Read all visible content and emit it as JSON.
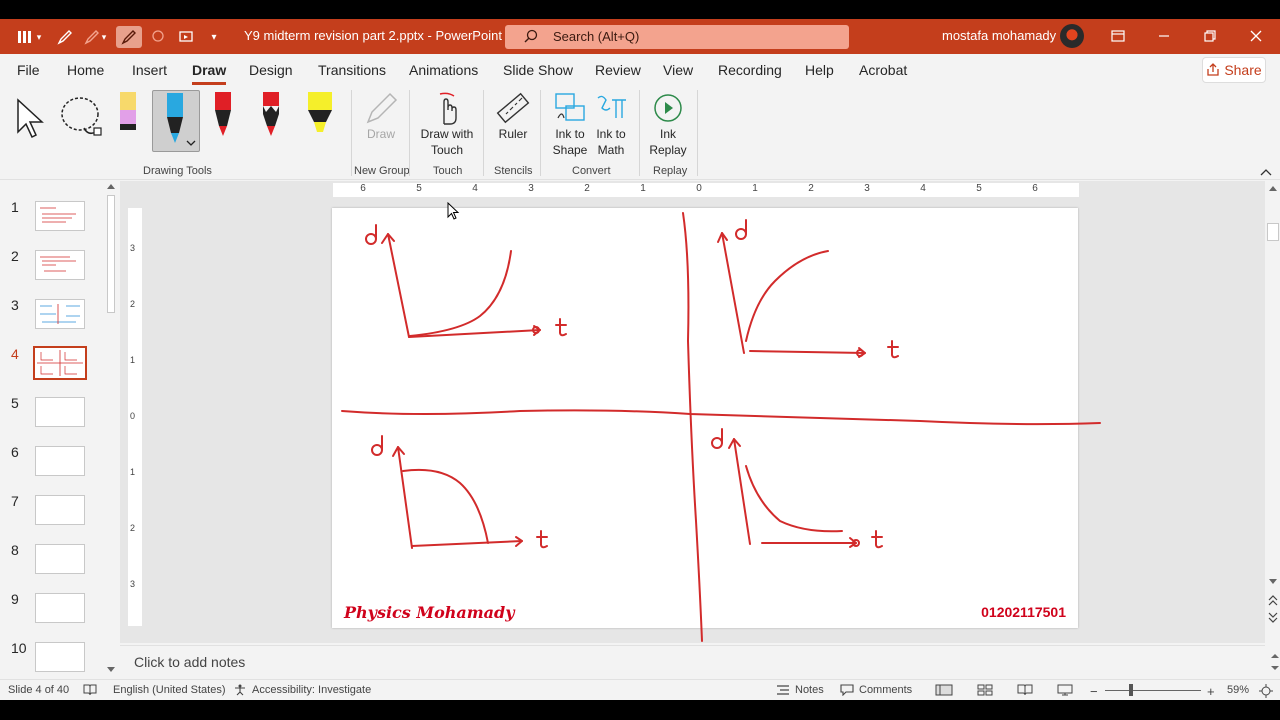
{
  "window": {
    "doc_title": "Y9 midterm revision part 2.pptx  -  PowerPoint",
    "search_placeholder": "Search (Alt+Q)",
    "user_name": "mostafa mohamady"
  },
  "tabs": [
    "File",
    "Home",
    "Insert",
    "Draw",
    "Design",
    "Transitions",
    "Animations",
    "Slide Show",
    "Review",
    "View",
    "Recording",
    "Help",
    "Acrobat"
  ],
  "active_tab": "Draw",
  "share_label": "Share",
  "ribbon": {
    "drawing_tools_label": "Drawing Tools",
    "draw_label": "Draw",
    "new_group_label": "New Group",
    "draw_with_touch_label": "Draw with Touch",
    "touch_label": "Touch",
    "ruler_label": "Ruler",
    "stencils_label": "Stencils",
    "ink_to_shape_label": "Ink to Shape",
    "ink_to_math_label": "Ink to Math",
    "convert_label": "Convert",
    "ink_replay_label": "Ink Replay",
    "replay_label": "Replay",
    "pen_colors": [
      "#f7d96b",
      "#29a8e0",
      "#e01f26",
      "#e01f26",
      "#f5ef2a"
    ]
  },
  "thumbnails": [
    {
      "num": "1"
    },
    {
      "num": "2"
    },
    {
      "num": "3"
    },
    {
      "num": "4"
    },
    {
      "num": "5"
    },
    {
      "num": "6"
    },
    {
      "num": "7"
    },
    {
      "num": "8"
    },
    {
      "num": "9"
    },
    {
      "num": "10"
    }
  ],
  "active_slide": 4,
  "ruler": {
    "horizontal": [
      "6",
      "5",
      "4",
      "3",
      "2",
      "1",
      "0",
      "1",
      "2",
      "3",
      "4",
      "5",
      "6"
    ],
    "vertical": [
      "3",
      "2",
      "1",
      "0",
      "1",
      "2",
      "3"
    ]
  },
  "slide": {
    "graph_labels": {
      "g1_y": "d",
      "g1_x": "t",
      "g2_y": "d",
      "g2_x": "t",
      "g3_y": "d",
      "g3_x": "t",
      "g4_y": "d",
      "g4_x": "t"
    },
    "footer_left": "Physics Mohamady",
    "footer_right": "01202117501",
    "ink_color": "#d22b2b"
  },
  "notes_placeholder": "Click to add notes",
  "status": {
    "slide_info": "Slide 4 of 40",
    "language": "English (United States)",
    "accessibility": "Accessibility: Investigate",
    "notes_label": "Notes",
    "comments_label": "Comments",
    "zoom": "59%"
  },
  "colors": {
    "accent": "#c43e1c",
    "ink": "#d22b2b"
  }
}
